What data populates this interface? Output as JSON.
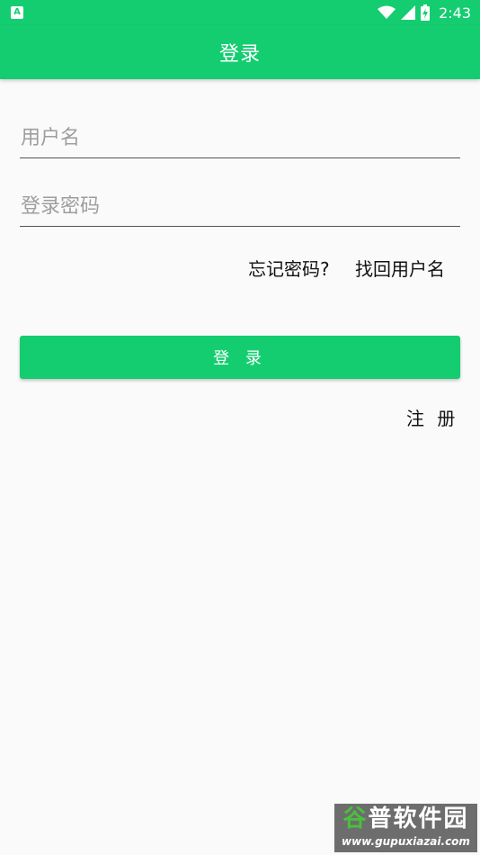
{
  "status_bar": {
    "notification_icon": "A",
    "time": "2:43",
    "icons": [
      "wifi-icon",
      "cellular-signal-icon",
      "battery-charging-icon"
    ]
  },
  "toolbar": {
    "title": "登录"
  },
  "form": {
    "username_placeholder": "用户名",
    "username_value": "",
    "password_placeholder": "登录密码",
    "password_value": ""
  },
  "links": {
    "forgot_password": "忘记密码?",
    "recover_username": "找回用户名",
    "register": "注 册"
  },
  "login_button": {
    "label": "登 录"
  },
  "watermark": {
    "text_green": "谷",
    "text_rest": "普软件园",
    "url": "www.gupuxiazai.com"
  },
  "colors": {
    "primary": "#14cd70",
    "background": "#fafafa"
  }
}
